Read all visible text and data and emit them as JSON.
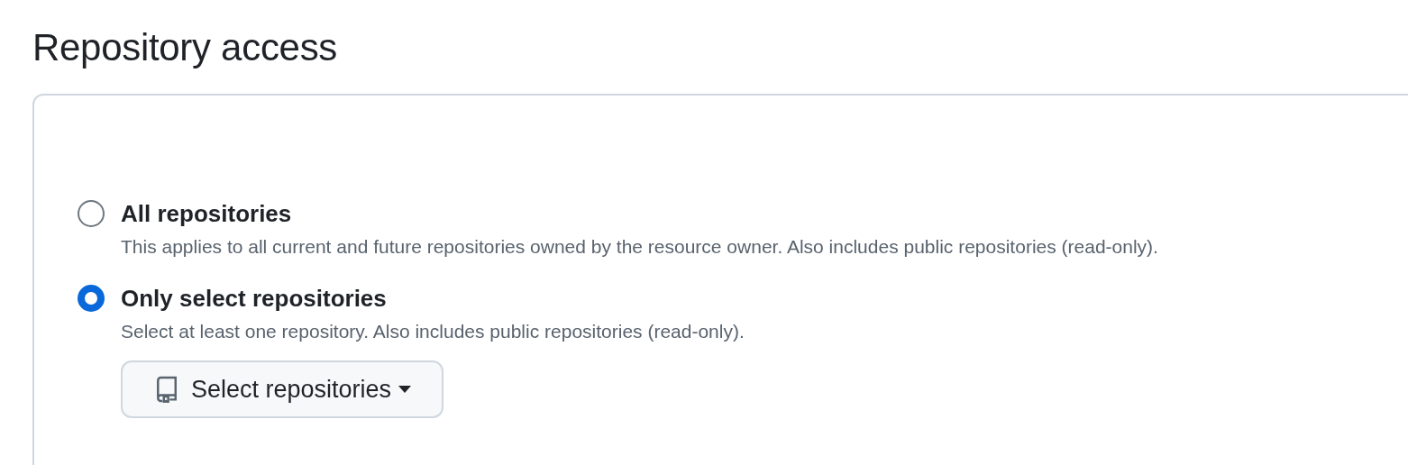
{
  "title": "Repository access",
  "options": [
    {
      "label": "All repositories",
      "description": "This applies to all current and future repositories owned by the resource owner. Also includes public repositories (read-only).",
      "selected": false
    },
    {
      "label": "Only select repositories",
      "description": "Select at least one repository. Also includes public repositories (read-only).",
      "selected": true,
      "button": {
        "label": "Select repositories"
      }
    }
  ]
}
